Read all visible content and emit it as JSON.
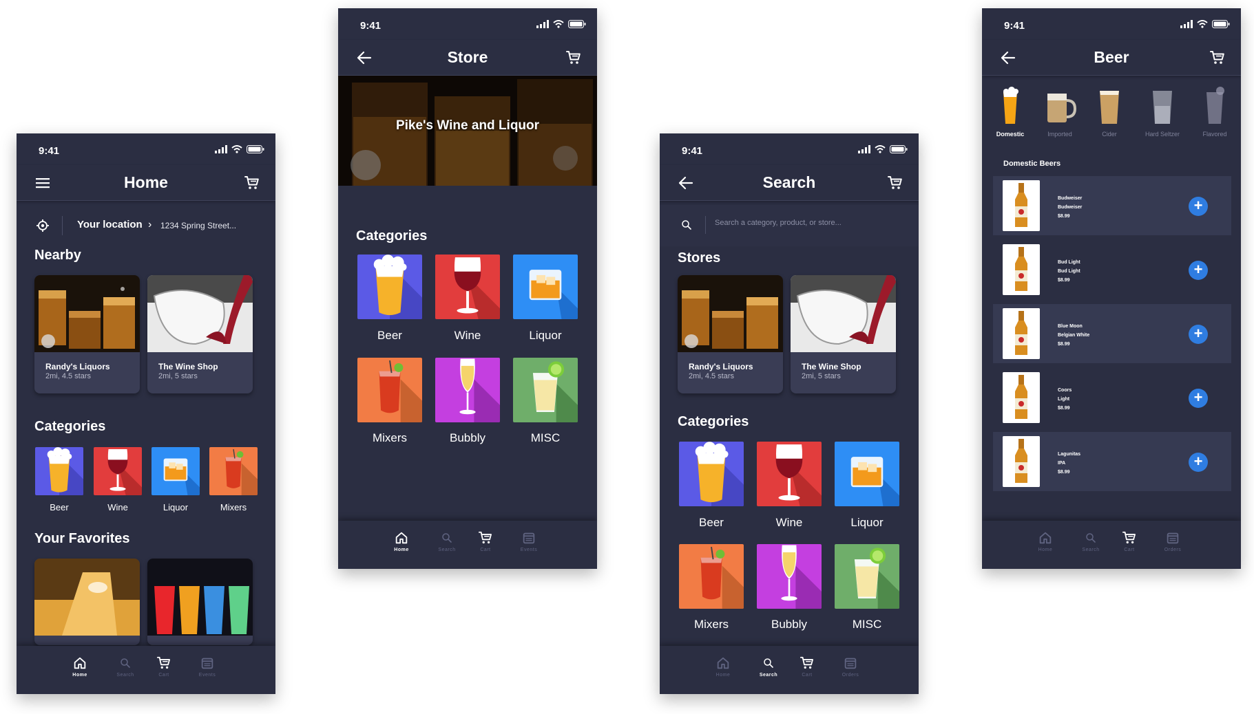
{
  "status": {
    "time": "9:41"
  },
  "home": {
    "title": "Home",
    "location_label": "Your location",
    "location_address": "1234 Spring Street...",
    "nearby_title": "Nearby",
    "stores": [
      {
        "name": "Randy's Liquors",
        "meta": "2mi, 4.5 stars"
      },
      {
        "name": "The Wine Shop",
        "meta": "2mi, 5 stars"
      }
    ],
    "categories_title": "Categories",
    "categories": [
      "Beer",
      "Wine",
      "Liquor",
      "Mixers"
    ],
    "favorites_title": "Your Favorites",
    "tabs": [
      "Home",
      "Search",
      "Cart",
      "Events"
    ]
  },
  "store": {
    "title": "Store",
    "hero_title": "Pike's Wine and Liquor",
    "categories_title": "Categories",
    "categories": [
      "Beer",
      "Wine",
      "Liquor",
      "Mixers",
      "Bubbly",
      "MISC"
    ],
    "tabs": [
      "Home",
      "Search",
      "Cart",
      "Events"
    ]
  },
  "search": {
    "title": "Search",
    "placeholder": "Search a category, product, or store...",
    "stores_title": "Stores",
    "stores": [
      {
        "name": "Randy's Liquors",
        "meta": "2mi, 4.5 stars"
      },
      {
        "name": "The Wine Shop",
        "meta": "2mi, 5 stars"
      }
    ],
    "categories_title": "Categories",
    "categories": [
      "Beer",
      "Wine",
      "Liquor",
      "Mixers",
      "Bubbly",
      "MISC"
    ],
    "tabs": [
      "Home",
      "Search",
      "Cart",
      "Orders"
    ]
  },
  "beer": {
    "title": "Beer",
    "subcategories": [
      "Domestic",
      "Imported",
      "Cider",
      "Hard Seltzer",
      "Flavored"
    ],
    "section_title": "Domestic Beers",
    "items": [
      {
        "brand": "Budweiser",
        "name": "Budweiser",
        "price": "$8.99"
      },
      {
        "brand": "Bud Light",
        "name": "Bud Light",
        "price": "$8.99"
      },
      {
        "brand": "Blue Moon",
        "name": "Belgian White",
        "price": "$8.99"
      },
      {
        "brand": "Coors",
        "name": "Light",
        "price": "$8.99"
      },
      {
        "brand": "Lagunitas",
        "name": "IPA",
        "price": "$8.99"
      }
    ],
    "tabs": [
      "Home",
      "Search",
      "Cart",
      "Orders"
    ]
  },
  "colors": {
    "background": "#2b2e42",
    "card": "#3a3d55",
    "beer_tile": "#5b5ae6",
    "wine_tile": "#e23d3d",
    "liquor_tile": "#2e8ef5",
    "mixers_tile": "#f27c45",
    "bubbly_tile": "#c43fe0",
    "misc_tile": "#6fae6a",
    "add_button": "#2f7de1"
  }
}
